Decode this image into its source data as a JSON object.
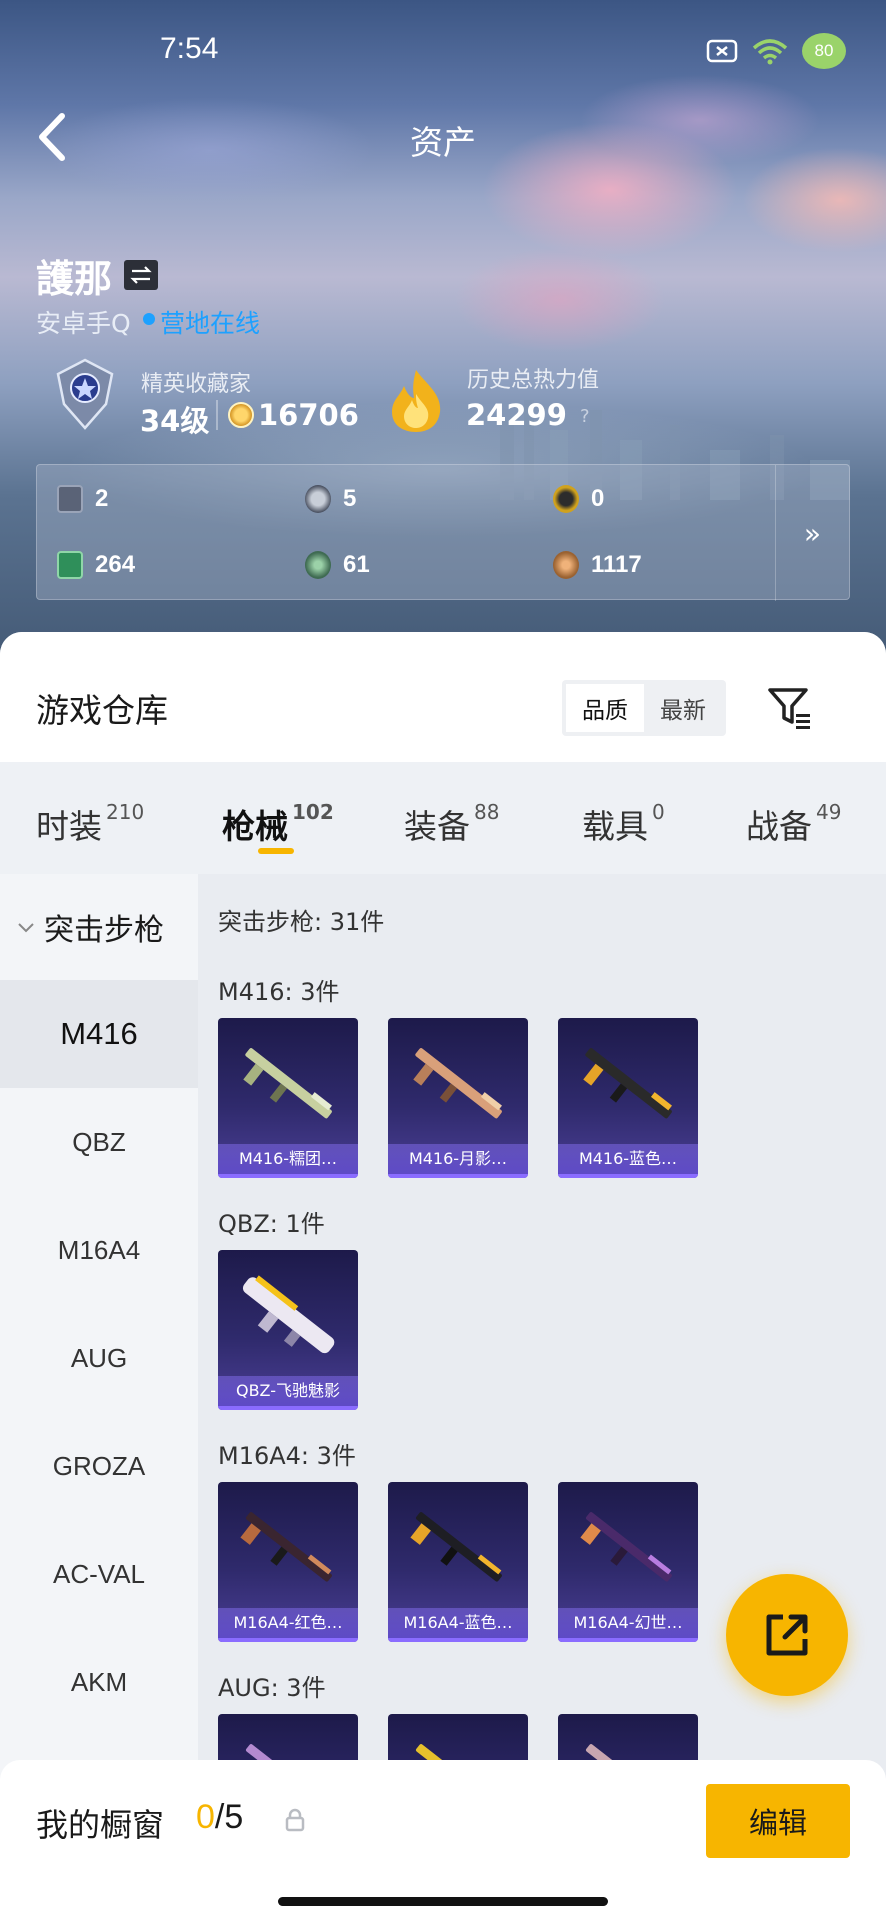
{
  "status": {
    "time": "7:54",
    "battery": "80"
  },
  "header": {
    "title": "资产"
  },
  "profile": {
    "name": "護那",
    "platform": "安卓手Q",
    "online_status": "营地在线",
    "rank_title": "精英收藏家",
    "rank_level": "34级",
    "rank_points": "16706",
    "heat_title": "历史总热力值",
    "heat_value": "24299",
    "help": "?"
  },
  "stats": [
    {
      "value": "2",
      "icon": "card-icon",
      "color": "#5a6377"
    },
    {
      "value": "5",
      "icon": "silver-coin-icon",
      "color": "#6d7585"
    },
    {
      "value": "0",
      "icon": "gold-badge-icon",
      "color": "#d0a21e"
    },
    {
      "value": "264",
      "icon": "green-card-icon",
      "color": "#2f8f5a"
    },
    {
      "value": "61",
      "icon": "green-orb-icon",
      "color": "#3f6b52"
    },
    {
      "value": "1117",
      "icon": "bronze-orb-icon",
      "color": "#9a6231"
    }
  ],
  "stats_more": "»",
  "warehouse": {
    "title": "游戏仓库",
    "sort_options": [
      "品质",
      "最新"
    ],
    "active_sort": "品质"
  },
  "tabs": [
    {
      "label": "时装",
      "count": "210"
    },
    {
      "label": "枪械",
      "count": "102",
      "active": true
    },
    {
      "label": "装备",
      "count": "88"
    },
    {
      "label": "载具",
      "count": "0"
    },
    {
      "label": "战备",
      "count": "49"
    }
  ],
  "sidebar": {
    "group": "突击步枪",
    "items": [
      "M416",
      "QBZ",
      "M16A4",
      "AUG",
      "GROZA",
      "AC-VAL",
      "AKM"
    ],
    "active": "M416"
  },
  "content": {
    "category_title": "突击步枪: 31件",
    "groups": [
      {
        "title": "M416: 3件",
        "items": [
          "M416-糯团…",
          "M416-月影…",
          "M416-蓝色…"
        ]
      },
      {
        "title": "QBZ: 1件",
        "items": [
          "QBZ-飞驰魅影"
        ]
      },
      {
        "title": "M16A4: 3件",
        "items": [
          "M16A4-红色…",
          "M16A4-蓝色…",
          "M16A4-幻世…"
        ]
      },
      {
        "title": "AUG: 3件",
        "items": [
          "",
          "",
          ""
        ]
      }
    ]
  },
  "bottom": {
    "showcase_label": "我的橱窗",
    "current": "0",
    "total": "/5",
    "edit_label": "编辑"
  },
  "colors": {
    "accent": "#f7b500",
    "online": "#1da1ff"
  }
}
